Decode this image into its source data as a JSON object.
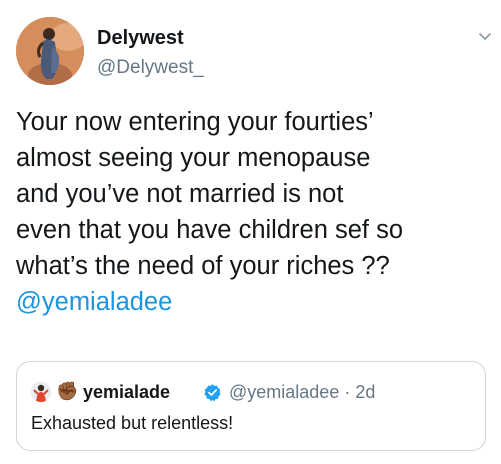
{
  "tweet": {
    "author": {
      "display_name": "Delywest",
      "handle": "@Delywest_"
    },
    "body_lines": [
      "Your now entering your fourties’",
      "almost seeing your menopause",
      "and you’ve not married is not",
      "even that you have children sef so",
      "what’s the need of your riches ??"
    ],
    "mention": "@yemialadee",
    "menu_icon": "chevron-down-icon"
  },
  "quoted_tweet": {
    "emoji": "✊🏾",
    "display_name": "yemialade",
    "verified_icon": "verified-badge-icon",
    "handle_and_time": "@yemialadee · 2d",
    "text": "Exhausted but relentless!"
  },
  "colors": {
    "link": "#1b95e0",
    "secondary_text": "#657786",
    "primary_text": "#14171a",
    "border": "#ccd6dd",
    "verified": "#1da1f2"
  }
}
